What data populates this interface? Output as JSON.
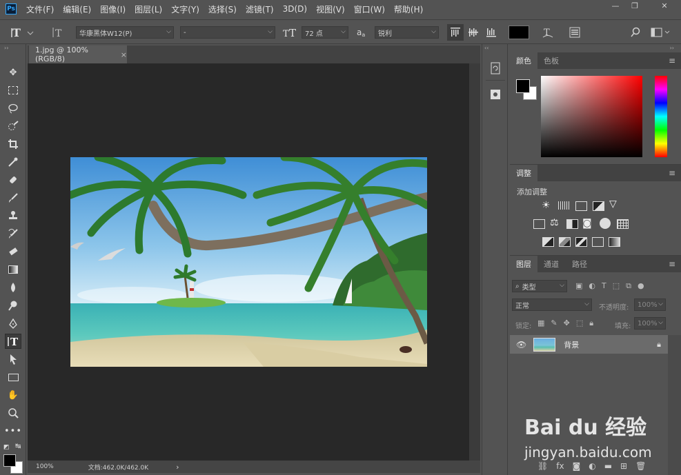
{
  "app": {
    "logo": "Ps"
  },
  "menu": [
    "文件(F)",
    "编辑(E)",
    "图像(I)",
    "图层(L)",
    "文字(Y)",
    "选择(S)",
    "滤镜(T)",
    "3D(D)",
    "视图(V)",
    "窗口(W)",
    "帮助(H)"
  ],
  "window_controls": {
    "minimize": "—",
    "restore": "❐",
    "close": "✕"
  },
  "options": {
    "font_family": "华康黑体W12(P)",
    "font_style": "-",
    "font_size": "72 点",
    "aa_label": "a",
    "aa_sub": "a",
    "antialias": "锐利",
    "text_color": "#000000"
  },
  "document": {
    "tab_title": "1.jpg @ 100%(RGB/8)",
    "tab_close": "×",
    "zoom": "100%",
    "doc_info": "文档:462.0K/462.0K",
    "status_arrow": "›"
  },
  "color_panel": {
    "tabs": [
      "颜色",
      "色板"
    ],
    "foreground": "#000000",
    "background": "#ffffff"
  },
  "adjustments_panel": {
    "tab": "调整",
    "add_label": "添加调整"
  },
  "layers_panel": {
    "tabs": [
      "图层",
      "通道",
      "路径"
    ],
    "filter_kind": "类型",
    "blend_mode": "正常",
    "opacity_label": "不透明度:",
    "opacity_value": "100%",
    "lock_label": "锁定:",
    "fill_label": "填充:",
    "fill_value": "100%",
    "layer_name": "背景"
  },
  "footer": {
    "fx": "fx"
  },
  "watermark": {
    "brand": "Bai du 经验",
    "url": "jingyan.baidu.com"
  },
  "colors": {
    "ui_bg": "#535353",
    "canvas_bg": "#282828",
    "accent_blue": "#31a8ff"
  }
}
